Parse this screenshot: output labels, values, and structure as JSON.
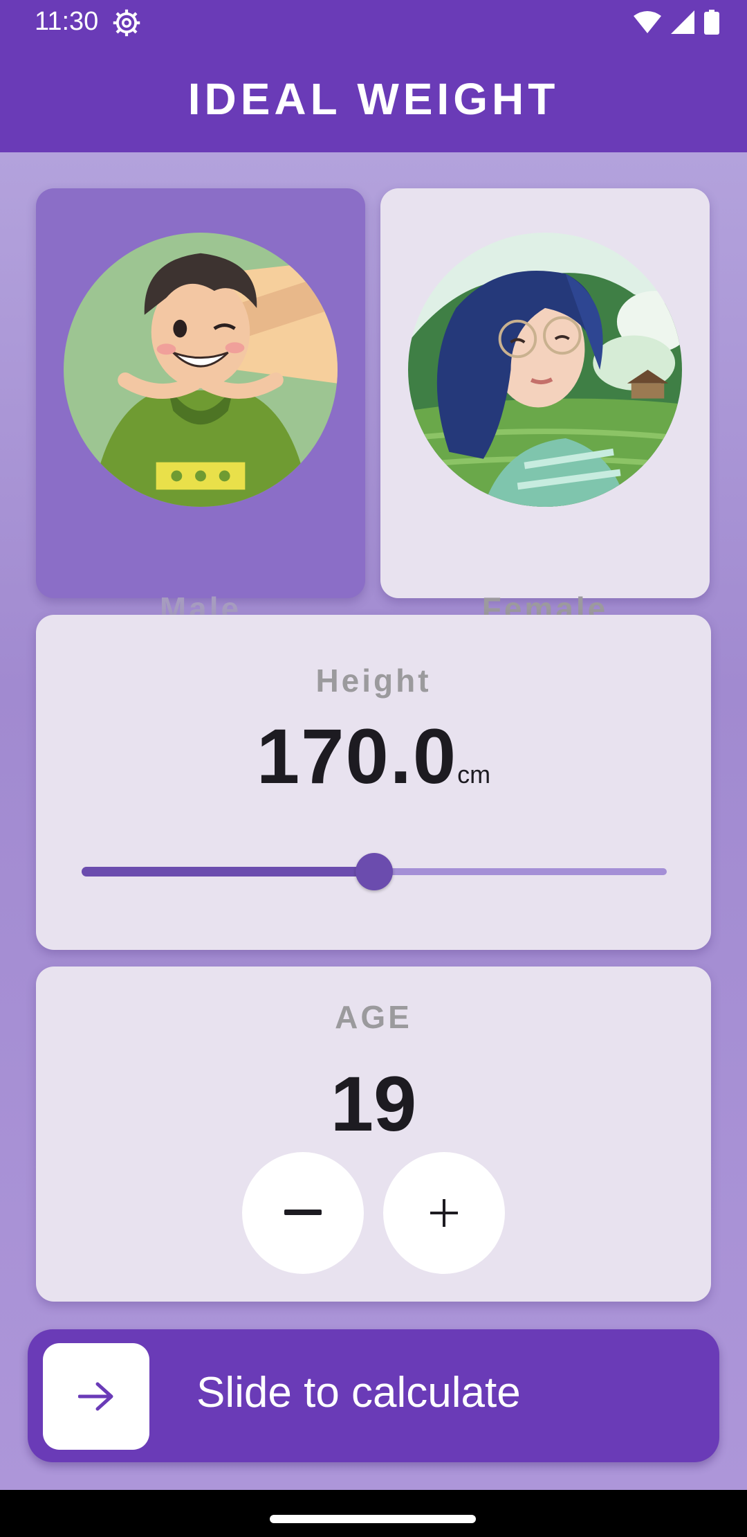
{
  "status_bar": {
    "time": "11:30"
  },
  "app_bar": {
    "title": "IDEAL WEIGHT"
  },
  "gender": {
    "selected": "male",
    "male_label": "Male",
    "female_label": "Female"
  },
  "height": {
    "label": "Height",
    "value": "170.0",
    "unit": "cm",
    "slider_fraction": 0.5
  },
  "age": {
    "label": "AGE",
    "value": "19"
  },
  "action": {
    "label": "Slide to calculate"
  },
  "colors": {
    "primary": "#6a3bb7",
    "card": "#e8e2ef",
    "selected_card": "#8b6ec7",
    "slider": "#6b4cae"
  }
}
